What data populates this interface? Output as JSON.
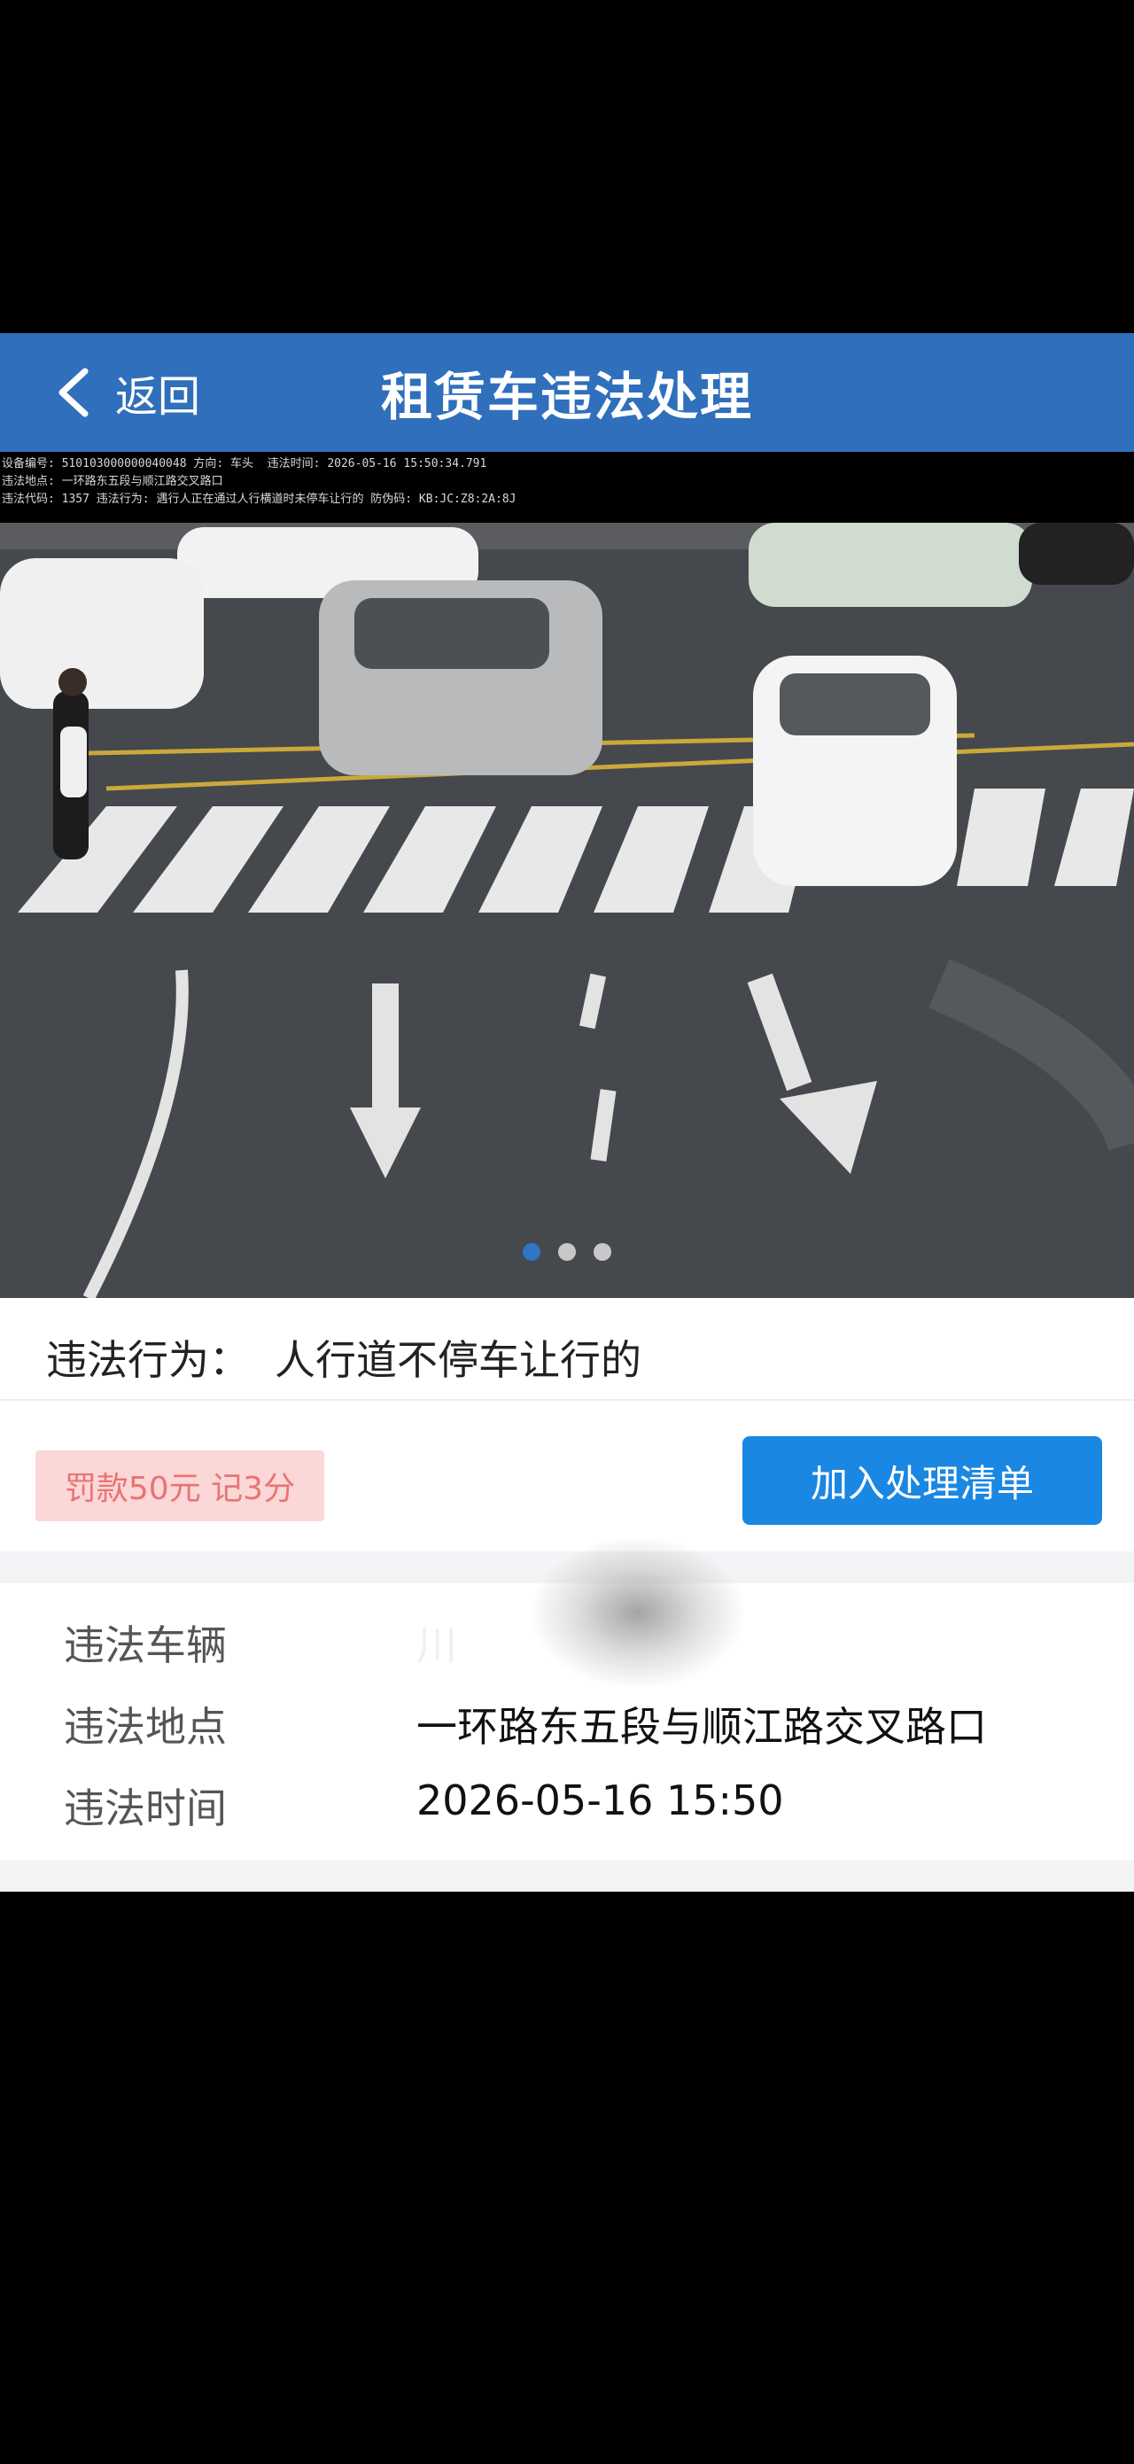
{
  "header": {
    "back_label": "返回",
    "title": "租赁车违法处理"
  },
  "photo": {
    "watermark_lines": [
      "设备编号: 510103000000040048 方向: 车头  违法时间: 2026-05-16 15:50:34.791",
      "违法地点: 一环路东五段与顺江路交叉路口",
      "违法代码: 1357 违法行为: 遇行人正在通过人行横道时未停车让行的 防伪码: KB:JC:Z8:2A:8J"
    ],
    "page_count": 3,
    "current_page": 1
  },
  "violation": {
    "label": "违法行为：",
    "value": "人行道不停车让行的"
  },
  "actions": {
    "fine_text": "罚款50元  记3分",
    "add_button": "加入处理清单"
  },
  "details": {
    "vehicle_label": "违法车辆",
    "vehicle_value": "川",
    "location_label": "违法地点",
    "location_value": "一环路东五段与顺江路交叉路口",
    "time_label": "违法时间",
    "time_value": "2026-05-16 15:50"
  },
  "colors": {
    "header_bg": "#2f6fbb",
    "primary_button": "#1a87e2",
    "fine_badge_bg": "#fbd7d7",
    "fine_badge_text": "#e87474"
  }
}
